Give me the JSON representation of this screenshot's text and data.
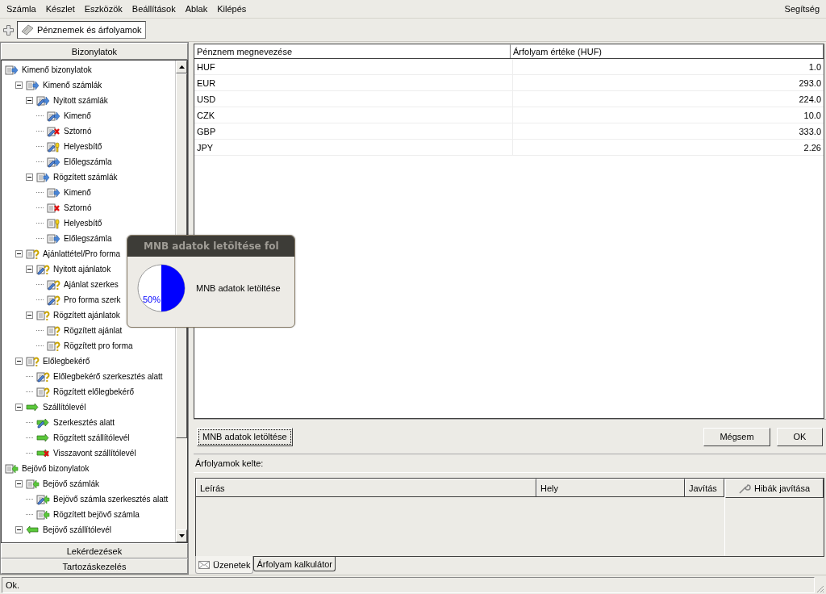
{
  "menu_bar": {
    "items": [
      "Számla",
      "Készlet",
      "Eszközök",
      "Beállítások",
      "Ablak",
      "Kilépés"
    ],
    "help": "Segítség"
  },
  "toolbar": {
    "tabs": [
      {
        "label": "Pénznemek és árfolyamok",
        "selected": true
      }
    ]
  },
  "sidebar": {
    "header": "Bizonylatok",
    "tree": [
      {
        "label": "Kimenő bizonylatok",
        "kind": "out",
        "children": [
          {
            "label": "Kimenő számlák",
            "kind": "out",
            "expanded": true,
            "children": [
              {
                "label": "Nyitott számlák",
                "kind": "out-edit",
                "expanded": true,
                "children": [
                  {
                    "label": "Kimenő",
                    "kind": "out-edit"
                  },
                  {
                    "label": "Sztornó",
                    "kind": "cancel-edit"
                  },
                  {
                    "label": "Helyesbítő",
                    "kind": "correct-edit"
                  },
                  {
                    "label": "Előlegszámla",
                    "kind": "out-edit"
                  }
                ]
              },
              {
                "label": "Rögzített számlák",
                "kind": "out",
                "expanded": true,
                "children": [
                  {
                    "label": "Kimenő",
                    "kind": "out"
                  },
                  {
                    "label": "Sztornó",
                    "kind": "cancel"
                  },
                  {
                    "label": "Helyesbítő",
                    "kind": "correct"
                  },
                  {
                    "label": "Előlegszámla",
                    "kind": "out"
                  }
                ]
              }
            ]
          },
          {
            "label": "Ajánlattétel/Pro forma",
            "kind": "quote",
            "expanded": true,
            "children": [
              {
                "label": "Nyitott ajánlatok",
                "kind": "quote-edit",
                "expanded": true,
                "children": [
                  {
                    "label": "Ajánlat szerkes",
                    "kind": "quote-edit"
                  },
                  {
                    "label": "Pro forma szerk",
                    "kind": "quote-edit"
                  }
                ]
              },
              {
                "label": "Rögzített ajánlatok",
                "kind": "quote",
                "expanded": true,
                "children": [
                  {
                    "label": "Rögzített ajánlat",
                    "kind": "quote"
                  },
                  {
                    "label": "Rögzített pro forma",
                    "kind": "quote"
                  }
                ]
              }
            ]
          },
          {
            "label": "Előlegbekérő",
            "kind": "quote",
            "expanded": true,
            "children": [
              {
                "label": "Előlegbekérő szerkesztés alatt",
                "kind": "quote-edit"
              },
              {
                "label": "Rögzített előlegbekérő",
                "kind": "quote"
              }
            ]
          },
          {
            "label": "Szállítólevél",
            "kind": "delivery",
            "expanded": true,
            "children": [
              {
                "label": "Szerkesztés alatt",
                "kind": "delivery-edit"
              },
              {
                "label": "Rögzített szállítólevél",
                "kind": "delivery"
              },
              {
                "label": "Visszavont szállítólevél",
                "kind": "delivery-cancel"
              }
            ]
          }
        ]
      },
      {
        "label": "Bejövő bizonylatok",
        "kind": "in",
        "children": [
          {
            "label": "Bejövő számlák",
            "kind": "in",
            "expanded": true,
            "children": [
              {
                "label": "Bejövő számla szerkesztés alatt",
                "kind": "in-edit"
              },
              {
                "label": "Rögzített bejövő számla",
                "kind": "in"
              }
            ]
          },
          {
            "label": "Bejövő szállítólevél",
            "kind": "in-delivery",
            "expanded": true
          }
        ]
      }
    ],
    "sections": [
      "Lekérdezések",
      "Tartozáskezelés"
    ]
  },
  "currency_table": {
    "columns": [
      "Pénznem megnevezése",
      "Árfolyam értéke (HUF)"
    ],
    "rows": [
      {
        "currency": "HUF",
        "rate": "1.0"
      },
      {
        "currency": "EUR",
        "rate": "293.0"
      },
      {
        "currency": "USD",
        "rate": "224.0"
      },
      {
        "currency": "CZK",
        "rate": "10.0"
      },
      {
        "currency": "GBP",
        "rate": "333.0"
      },
      {
        "currency": "JPY",
        "rate": "2.26"
      }
    ]
  },
  "buttons": {
    "download": "MNB adatok letöltése",
    "cancel": "Mégsem",
    "ok": "OK"
  },
  "rates_date_label": "Árfolyamok kelte:",
  "messages": {
    "columns": [
      "Leírás",
      "Hely",
      "Javítás"
    ],
    "fix_button": "Hibák javítása",
    "tabs": [
      {
        "label": "Üzenetek",
        "selected": true
      },
      {
        "label": "Árfolyam kalkulátor",
        "selected": false
      }
    ]
  },
  "status_bar": "Ok.",
  "progress_dialog": {
    "title": "MNB adatok letöltése fol",
    "level": 0.5,
    "percent": "50%",
    "message": "MNB adatok letöltése"
  }
}
